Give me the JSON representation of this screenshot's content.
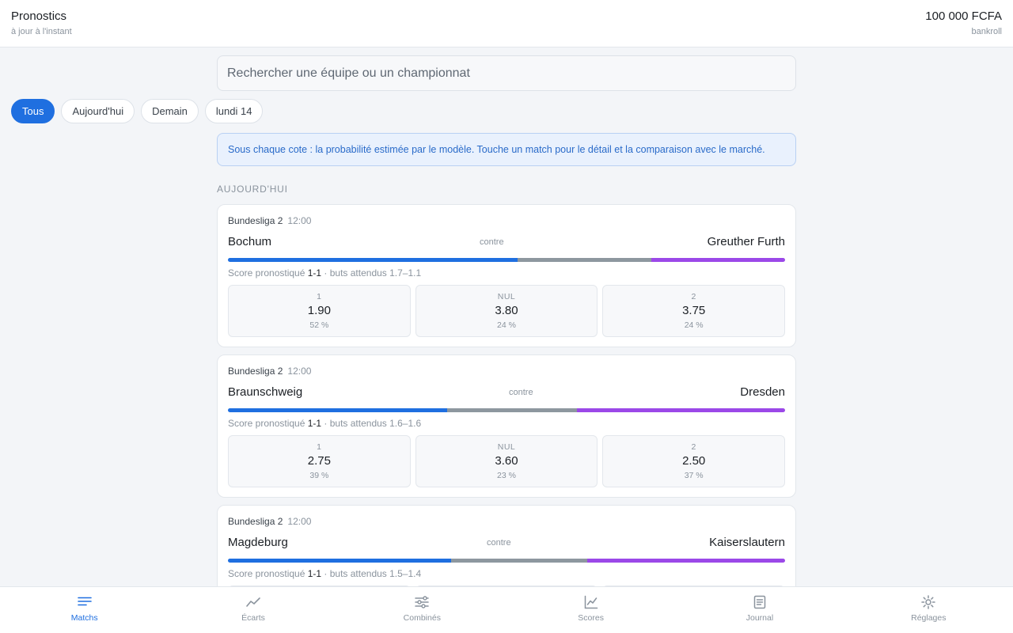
{
  "header": {
    "title": "Pronostics",
    "subtitle": "à jour à l'instant",
    "bankroll_amount": "100 000 FCFA",
    "bankroll_label": "bankroll"
  },
  "search": {
    "placeholder": "Rechercher une équipe ou un championnat"
  },
  "filters": [
    "Tous",
    "Aujourd'hui",
    "Demain",
    "lundi 14"
  ],
  "active_filter": "Tous",
  "info_banner": "Sous chaque cote : la probabilité estimée par le modèle. Touche un match pour le détail et la comparaison avec le marché.",
  "section_label": "AUJOURD'HUI",
  "matches": [
    {
      "league": "Bundesliga 2",
      "time": "12:00",
      "home": "Bochum",
      "vs": "contre",
      "away": "Greuther Furth",
      "prob_home": 52,
      "prob_draw": 24,
      "prob_away": 24,
      "prediction_prefix": "Score pronostiqué ",
      "score": "1-1",
      "goals_text": " · buts attendus 1.7–1.1",
      "odds": [
        {
          "label": "1",
          "value": "1.90",
          "prob": "52 %"
        },
        {
          "label": "NUL",
          "value": "3.80",
          "prob": "24 %"
        },
        {
          "label": "2",
          "value": "3.75",
          "prob": "24 %"
        }
      ]
    },
    {
      "league": "Bundesliga 2",
      "time": "12:00",
      "home": "Braunschweig",
      "vs": "contre",
      "away": "Dresden",
      "prob_home": 39,
      "prob_draw": 23,
      "prob_away": 37,
      "prediction_prefix": "Score pronostiqué ",
      "score": "1-1",
      "goals_text": " · buts attendus 1.6–1.6",
      "odds": [
        {
          "label": "1",
          "value": "2.75",
          "prob": "39 %"
        },
        {
          "label": "NUL",
          "value": "3.60",
          "prob": "23 %"
        },
        {
          "label": "2",
          "value": "2.50",
          "prob": "37 %"
        }
      ]
    },
    {
      "league": "Bundesliga 2",
      "time": "12:00",
      "home": "Magdeburg",
      "vs": "contre",
      "away": "Kaiserslautern",
      "prob_home": 40,
      "prob_draw": 24.5,
      "prob_away": 35.5,
      "prediction_prefix": "Score pronostiqué ",
      "score": "1-1",
      "goals_text": " · buts attendus 1.5–1.4",
      "odds": []
    }
  ],
  "nav": [
    {
      "label": "Matchs",
      "icon": "matches-icon",
      "active": true
    },
    {
      "label": "Écarts",
      "icon": "trend-icon",
      "active": false
    },
    {
      "label": "Combinés",
      "icon": "sliders-icon",
      "active": false
    },
    {
      "label": "Scores",
      "icon": "chart-icon",
      "active": false
    },
    {
      "label": "Journal",
      "icon": "journal-icon",
      "active": false
    },
    {
      "label": "Réglages",
      "icon": "settings-icon",
      "active": false
    }
  ],
  "colors": {
    "accent": "#1f6fe0",
    "home": "#1f6fe0",
    "draw": "#8d979f",
    "away": "#9b48e8"
  }
}
